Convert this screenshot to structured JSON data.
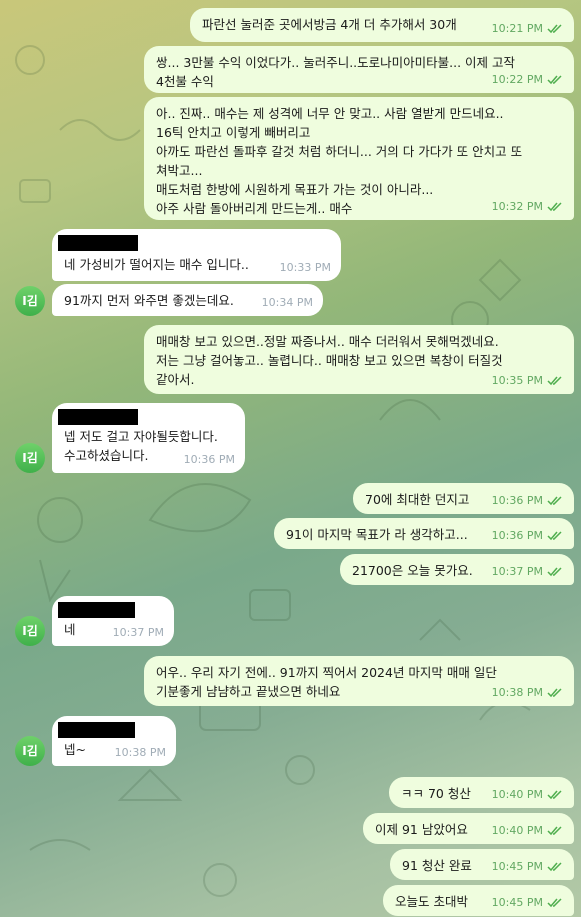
{
  "avatar_label": "I김",
  "messages": [
    {
      "text": "파란선 눌러준 곳에서방금 4개 더 추가해서 30개",
      "time": "10:21 PM"
    },
    {
      "text": "쌍... 3만불 수익 이었다가.. 눌러주니..도로나미아미타불... 이제 고작\n4천불 수익",
      "time": "10:22 PM"
    },
    {
      "text": "아.. 진짜.. 매수는 제 성격에 너무 안 맞고.. 사람 열받게 만드네요..\n16틱 안치고 이렇게 빼버리고\n아까도 파란선 돌파후 갈것 처럼 하더니... 거의 다 가다가 또 안치고 또\n쳐박고...\n매도처럼 한방에 시원하게 목표가 가는 것이 아니라...\n아주 사람 돌아버리게 만드는게.. 매수",
      "time": "10:32 PM"
    },
    {
      "text": "네 가성비가 떨어지는 매수 입니다..",
      "time": "10:33 PM"
    },
    {
      "text": "91까지 먼저 와주면 좋겠는데요.",
      "time": "10:34 PM"
    },
    {
      "text": "매매창 보고 있으면..정말 짜증나서.. 매수 더러워서 못해먹겠네요.\n저는 그냥 걸어놓고.. 놀렵니다.. 매매창 보고 있으면 복창이 터질것\n같아서.",
      "time": "10:35 PM"
    },
    {
      "text": "넵 저도 걸고 자야될듯합니다.\n수고하셨습니다.",
      "time": "10:36 PM"
    },
    {
      "text": "70에 최대한 던지고",
      "time": "10:36 PM"
    },
    {
      "text": "91이 마지막 목표가 라 생각하고...",
      "time": "10:36 PM"
    },
    {
      "text": "21700은 오늘 못가요.",
      "time": "10:37 PM"
    },
    {
      "text": "네",
      "time": "10:37 PM"
    },
    {
      "text": "어우.. 우리 자기 전에.. 91까지 찍어서 2024년 마지막 매매 일단\n기분좋게 냠냠하고 끝냈으면 하네요",
      "time": "10:38 PM"
    },
    {
      "text": "넵~",
      "time": "10:38 PM"
    },
    {
      "text": "ㅋㅋ 70 청산",
      "time": "10:40 PM"
    },
    {
      "text": "이제 91 남았어요",
      "time": "10:40 PM"
    },
    {
      "text": "91 청산 완료",
      "time": "10:45 PM"
    },
    {
      "text": "오늘도 초대박",
      "time": "10:45 PM"
    }
  ]
}
